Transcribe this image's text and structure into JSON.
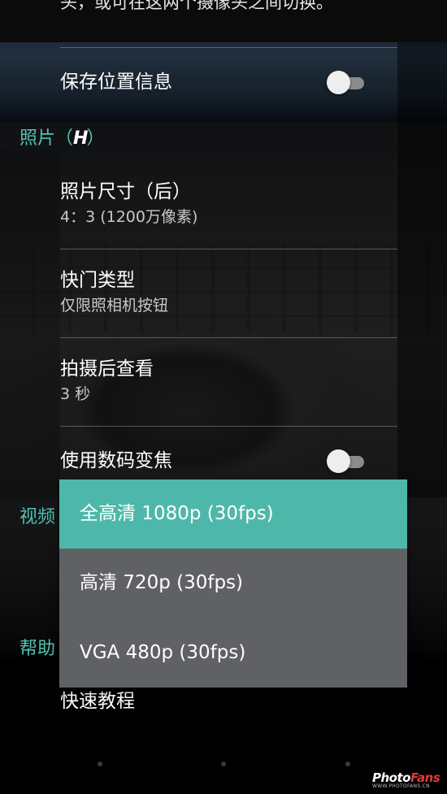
{
  "top_partial_text": "头，或可在这两个摄像头之间切换。",
  "settings": {
    "save_location": {
      "label": "保存位置信息",
      "enabled": false
    },
    "photo_section": {
      "title_prefix": "照片（",
      "logo": "H",
      "title_suffix": "）"
    },
    "photo_size": {
      "label": "照片尺寸（后）",
      "value": "4：3 (1200万像素)"
    },
    "shutter_type": {
      "label": "快门类型",
      "value": "仅限照相机按钮"
    },
    "review": {
      "label": "拍摄后查看",
      "value": "3 秒"
    },
    "digital_zoom": {
      "label": "使用数码变焦",
      "enabled": false
    },
    "video_section": {
      "title": "视频"
    },
    "help_section": {
      "title": "帮助"
    },
    "quick_tutorial": {
      "label": "快速教程"
    }
  },
  "resolution_popup": {
    "options": [
      {
        "label": "全高清 1080p (30fps)",
        "selected": true
      },
      {
        "label": "高清 720p (30fps)",
        "selected": false
      },
      {
        "label": "VGA 480p (30fps)",
        "selected": false
      }
    ]
  },
  "colors": {
    "accent": "#4fc3b3",
    "selected_item": "#4db8a9",
    "popup_bg": "#5f6164"
  },
  "watermark": {
    "brand_a": "Photo",
    "brand_b": "Fans",
    "url": "WWW.PHOTOFANS.CN"
  }
}
